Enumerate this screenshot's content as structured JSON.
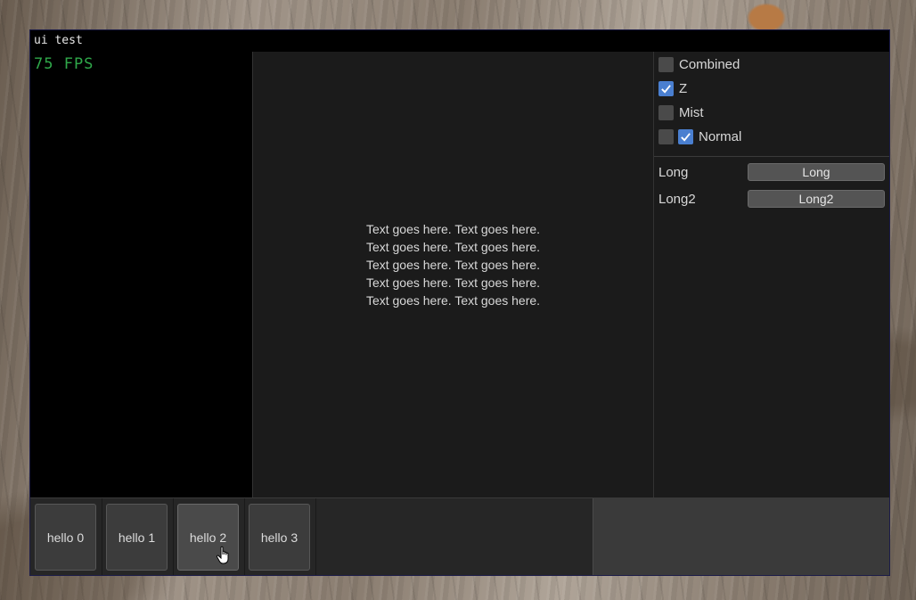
{
  "window": {
    "title": "ui test"
  },
  "left_panel": {
    "fps_text": "75 FPS",
    "fps_color": "#2fa84a"
  },
  "center_panel": {
    "lines": [
      "Text goes here. Text goes here.",
      "Text goes here. Text goes here.",
      "Text goes here. Text goes here.",
      "Text goes here. Text goes here.",
      "Text goes here. Text goes here."
    ]
  },
  "right_panel": {
    "checkboxes": [
      {
        "label": "Combined",
        "checked": false
      },
      {
        "label": "Z",
        "checked": true
      },
      {
        "label": "Mist",
        "checked": false
      },
      {
        "label": "Normal",
        "checked": true,
        "leading_unchecked": true
      }
    ],
    "properties": [
      {
        "label": "Long",
        "button": "Long"
      },
      {
        "label": "Long2",
        "button": "Long2"
      }
    ],
    "accent_color": "#4a7fd0"
  },
  "bottom_bar": {
    "buttons": [
      {
        "label": "hello 0"
      },
      {
        "label": "hello 1"
      },
      {
        "label": "hello 2",
        "hover": true
      },
      {
        "label": "hello 3"
      }
    ]
  }
}
